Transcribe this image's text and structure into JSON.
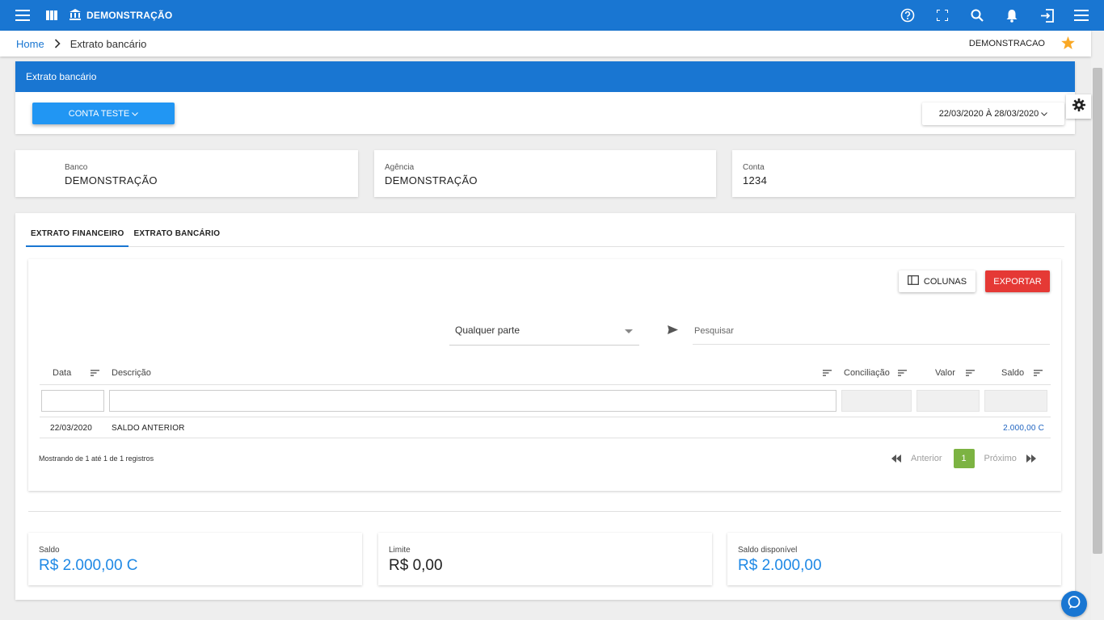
{
  "topbar": {
    "title": "DEMONSTRAÇÃO",
    "icons": [
      "menu-icon",
      "columns-icon",
      "bank-icon",
      "help-icon",
      "fullscreen-icon",
      "search-icon",
      "bell-icon",
      "exit-icon",
      "menu-icon"
    ],
    "color": "#1976d2"
  },
  "breadcrumb": {
    "home": "Home",
    "current": "Extrato bancário",
    "company": "DEMONSTRACAO"
  },
  "header": {
    "title": "Extrato bancário",
    "account_button": "CONTA TESTE",
    "date_range": "22/03/2020 À 28/03/2020"
  },
  "info": {
    "bank": {
      "label": "Banco",
      "value": "DEMONSTRAÇÃO"
    },
    "agency": {
      "label": "Agência",
      "value": "DEMONSTRAÇÃO"
    },
    "account": {
      "label": "Conta",
      "value": "1234"
    }
  },
  "tabs": [
    {
      "label": "EXTRATO FINANCEIRO",
      "active": true
    },
    {
      "label": "EXTRATO BANCÁRIO",
      "active": false
    }
  ],
  "toolbar": {
    "columns_label": "COLUNAS",
    "export_label": "EXPORTAR"
  },
  "search": {
    "mode": "Qualquer parte",
    "placeholder": "Pesquisar"
  },
  "table": {
    "headers": [
      "Data",
      "Descrição",
      "Conciliação",
      "Valor",
      "Saldo"
    ],
    "rows": [
      {
        "date": "22/03/2020",
        "description": "SALDO ANTERIOR",
        "reconciliation": "",
        "value": "",
        "balance": "2.000,00 C"
      }
    ]
  },
  "pagination": {
    "showing": "Mostrando de 1 até 1 de 1 registros",
    "previous": "Anterior",
    "page": "1",
    "next": "Próximo"
  },
  "summary": {
    "balance": {
      "label": "Saldo",
      "value": "R$ 2.000,00 C",
      "color": "#1e88e5"
    },
    "limit": {
      "label": "Limite",
      "value": "R$ 0,00",
      "color": "#212121"
    },
    "available": {
      "label": "Saldo disponível",
      "value": "R$ 2.000,00",
      "color": "#1e88e5"
    }
  },
  "colors": {
    "primary": "#1976d2",
    "button_blue": "#2196f3",
    "export_red": "#e53935",
    "page_green": "#7cb342",
    "star": "#f9a825"
  }
}
